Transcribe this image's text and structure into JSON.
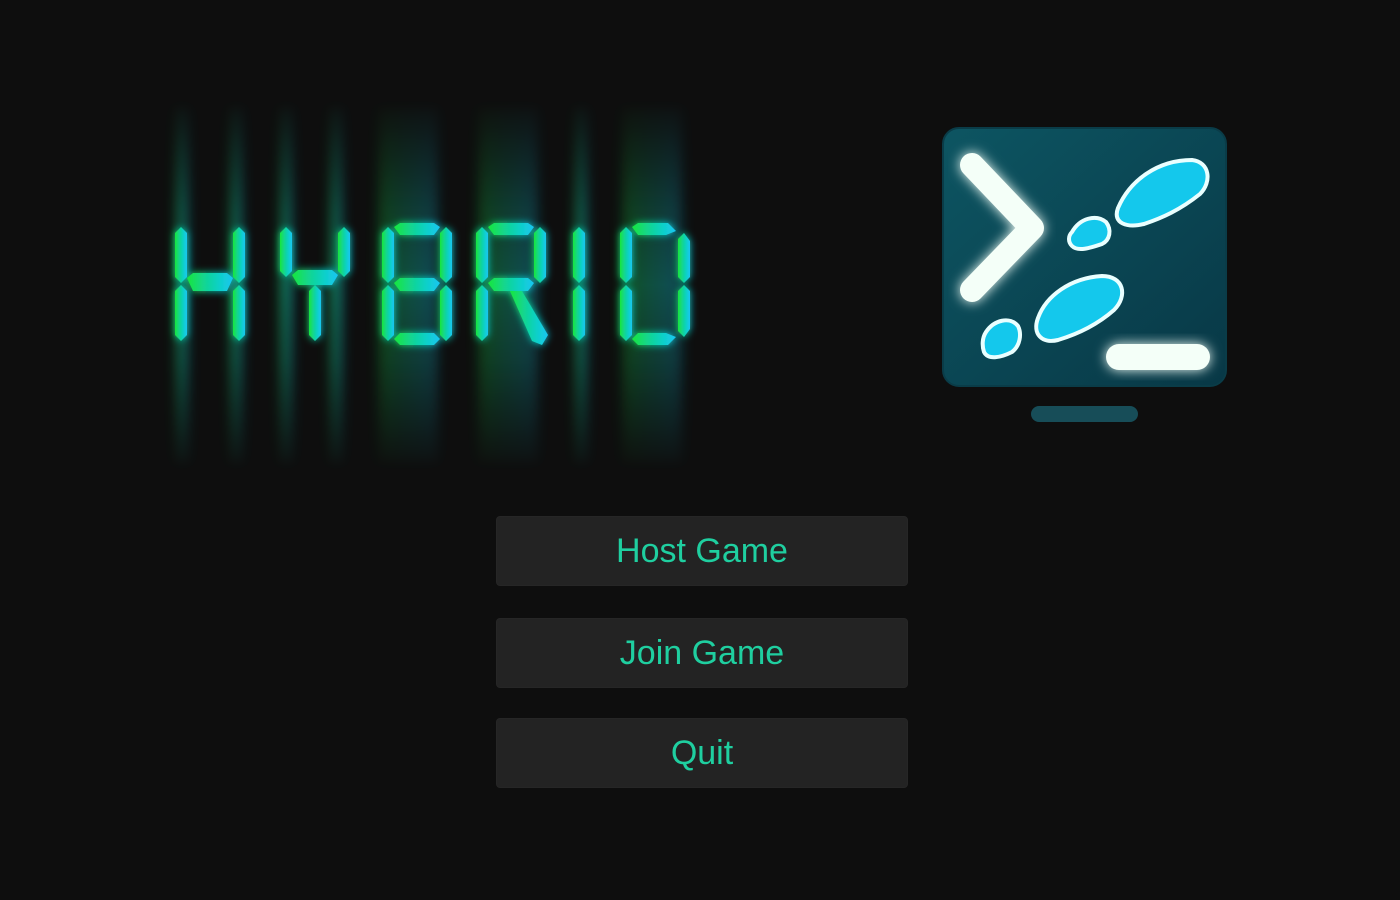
{
  "title": {
    "text": "HYBRID",
    "gradient": [
      "#19e63c",
      "#12d68c",
      "#0fd0d6",
      "#17c6f2"
    ]
  },
  "icon": {
    "name": "terminal-footsteps-icon",
    "panel_color": "#0b4a58",
    "glow_color": "#c8ffe0",
    "footprint_color": "#13c7ea"
  },
  "menu": {
    "host_label": "Host Game",
    "join_label": "Join Game",
    "quit_label": "Quit",
    "text_color": "#1fcfa0",
    "button_color": "#232323"
  }
}
